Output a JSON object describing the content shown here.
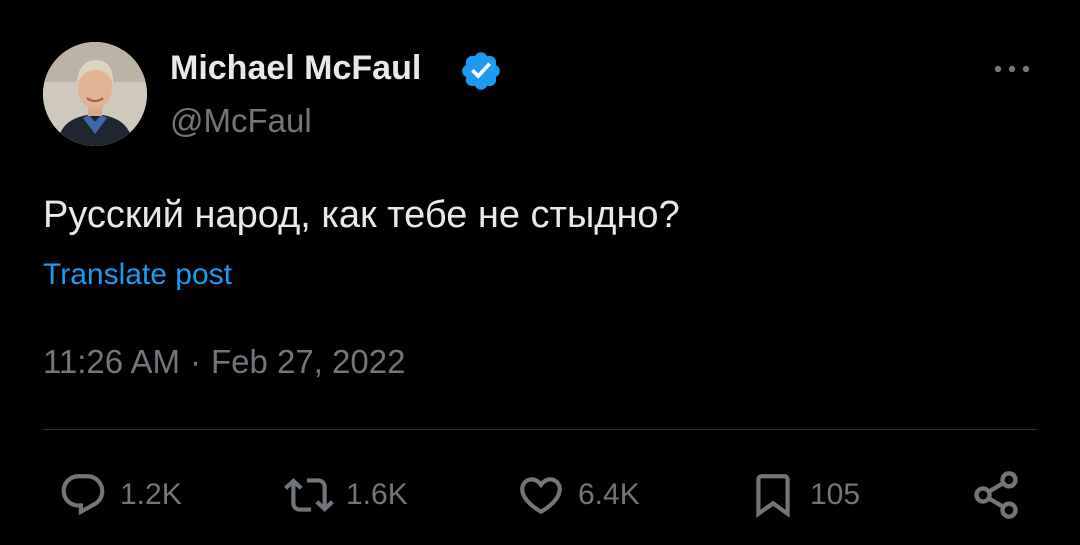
{
  "author": {
    "name": "Michael McFaul",
    "handle": "@McFaul",
    "verified_icon": "verified-badge-icon",
    "avatar_icon": "profile-photo"
  },
  "post": {
    "text": "Русский народ, как тебе не стыдно?",
    "translate_label": "Translate post",
    "time": "11:26 AM",
    "separator": "·",
    "date": "Feb 27, 2022"
  },
  "actions": {
    "reply": {
      "icon": "reply-icon",
      "count": "1.2K"
    },
    "repost": {
      "icon": "repost-icon",
      "count": "1.6K"
    },
    "like": {
      "icon": "heart-icon",
      "count": "6.4K"
    },
    "bookmark": {
      "icon": "bookmark-icon",
      "count": "105"
    },
    "share": {
      "icon": "share-icon"
    }
  },
  "menu": {
    "icon": "more-options-icon"
  },
  "colors": {
    "background": "#000000",
    "text_primary": "#e7e9ea",
    "text_secondary": "#71767b",
    "accent": "#1d9bf0",
    "divider": "#2f3336"
  }
}
